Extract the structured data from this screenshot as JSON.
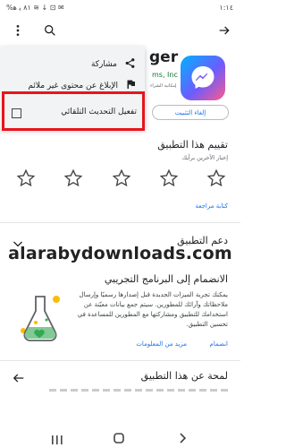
{
  "status": {
    "left": "%٨١ ﯾ ﮬ ≋ ↓ ⊡ ✉",
    "time": "١:١٤"
  },
  "icons": {
    "back": "arrow-right-icon",
    "search": "search-icon",
    "more": "more-vert-icon",
    "share": "share-icon",
    "flag": "flag-icon"
  },
  "app": {
    "name": "ger",
    "developer": "ms, Inc",
    "sub": "إمكانية الشراء"
  },
  "menu": {
    "share": "مشاركة",
    "report": "الإبلاغ عن محتوى غير ملائم",
    "auto_update": "تفعيل التحديث التلقائي"
  },
  "uninstall_label": "إلغاء التثبيت",
  "rating": {
    "title": "تقييم هذا التطبيق",
    "sub": "إخبار الآخرين برأيك",
    "write_review": "كتابة مراجعة"
  },
  "support": {
    "title": "دعم التطبيق"
  },
  "watermark": "alarabydownloads.com",
  "beta": {
    "title": "الانضمام إلى البرنامج التجريبي",
    "text": "يمكنك تجربة الميزات الجديدة قبل إصدارها رسميًا وإرسال ملاحظاتك وآرائك للمطورين. سيتم جمع بيانات معيّنة عن استخدامك للتطبيق ومشاركتها مع المطورين للمساعدة في تحسين التطبيق.",
    "join": "انضمام",
    "more_info": "مزيد من المعلومات"
  },
  "about": {
    "title": "لمحة عن هذا التطبيق"
  },
  "colors": {
    "highlight": "#e8141c",
    "link": "#1a73e8",
    "green": "#137333"
  }
}
